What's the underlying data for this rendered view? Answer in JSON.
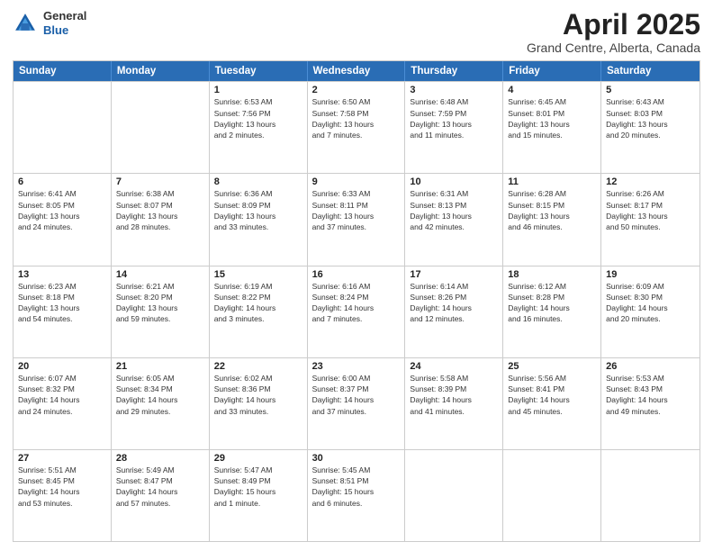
{
  "logo": {
    "general": "General",
    "blue": "Blue"
  },
  "header": {
    "month_year": "April 2025",
    "location": "Grand Centre, Alberta, Canada"
  },
  "weekdays": [
    "Sunday",
    "Monday",
    "Tuesday",
    "Wednesday",
    "Thursday",
    "Friday",
    "Saturday"
  ],
  "weeks": [
    [
      {
        "day": "",
        "info": ""
      },
      {
        "day": "",
        "info": ""
      },
      {
        "day": "1",
        "info": "Sunrise: 6:53 AM\nSunset: 7:56 PM\nDaylight: 13 hours\nand 2 minutes."
      },
      {
        "day": "2",
        "info": "Sunrise: 6:50 AM\nSunset: 7:58 PM\nDaylight: 13 hours\nand 7 minutes."
      },
      {
        "day": "3",
        "info": "Sunrise: 6:48 AM\nSunset: 7:59 PM\nDaylight: 13 hours\nand 11 minutes."
      },
      {
        "day": "4",
        "info": "Sunrise: 6:45 AM\nSunset: 8:01 PM\nDaylight: 13 hours\nand 15 minutes."
      },
      {
        "day": "5",
        "info": "Sunrise: 6:43 AM\nSunset: 8:03 PM\nDaylight: 13 hours\nand 20 minutes."
      }
    ],
    [
      {
        "day": "6",
        "info": "Sunrise: 6:41 AM\nSunset: 8:05 PM\nDaylight: 13 hours\nand 24 minutes."
      },
      {
        "day": "7",
        "info": "Sunrise: 6:38 AM\nSunset: 8:07 PM\nDaylight: 13 hours\nand 28 minutes."
      },
      {
        "day": "8",
        "info": "Sunrise: 6:36 AM\nSunset: 8:09 PM\nDaylight: 13 hours\nand 33 minutes."
      },
      {
        "day": "9",
        "info": "Sunrise: 6:33 AM\nSunset: 8:11 PM\nDaylight: 13 hours\nand 37 minutes."
      },
      {
        "day": "10",
        "info": "Sunrise: 6:31 AM\nSunset: 8:13 PM\nDaylight: 13 hours\nand 42 minutes."
      },
      {
        "day": "11",
        "info": "Sunrise: 6:28 AM\nSunset: 8:15 PM\nDaylight: 13 hours\nand 46 minutes."
      },
      {
        "day": "12",
        "info": "Sunrise: 6:26 AM\nSunset: 8:17 PM\nDaylight: 13 hours\nand 50 minutes."
      }
    ],
    [
      {
        "day": "13",
        "info": "Sunrise: 6:23 AM\nSunset: 8:18 PM\nDaylight: 13 hours\nand 54 minutes."
      },
      {
        "day": "14",
        "info": "Sunrise: 6:21 AM\nSunset: 8:20 PM\nDaylight: 13 hours\nand 59 minutes."
      },
      {
        "day": "15",
        "info": "Sunrise: 6:19 AM\nSunset: 8:22 PM\nDaylight: 14 hours\nand 3 minutes."
      },
      {
        "day": "16",
        "info": "Sunrise: 6:16 AM\nSunset: 8:24 PM\nDaylight: 14 hours\nand 7 minutes."
      },
      {
        "day": "17",
        "info": "Sunrise: 6:14 AM\nSunset: 8:26 PM\nDaylight: 14 hours\nand 12 minutes."
      },
      {
        "day": "18",
        "info": "Sunrise: 6:12 AM\nSunset: 8:28 PM\nDaylight: 14 hours\nand 16 minutes."
      },
      {
        "day": "19",
        "info": "Sunrise: 6:09 AM\nSunset: 8:30 PM\nDaylight: 14 hours\nand 20 minutes."
      }
    ],
    [
      {
        "day": "20",
        "info": "Sunrise: 6:07 AM\nSunset: 8:32 PM\nDaylight: 14 hours\nand 24 minutes."
      },
      {
        "day": "21",
        "info": "Sunrise: 6:05 AM\nSunset: 8:34 PM\nDaylight: 14 hours\nand 29 minutes."
      },
      {
        "day": "22",
        "info": "Sunrise: 6:02 AM\nSunset: 8:36 PM\nDaylight: 14 hours\nand 33 minutes."
      },
      {
        "day": "23",
        "info": "Sunrise: 6:00 AM\nSunset: 8:37 PM\nDaylight: 14 hours\nand 37 minutes."
      },
      {
        "day": "24",
        "info": "Sunrise: 5:58 AM\nSunset: 8:39 PM\nDaylight: 14 hours\nand 41 minutes."
      },
      {
        "day": "25",
        "info": "Sunrise: 5:56 AM\nSunset: 8:41 PM\nDaylight: 14 hours\nand 45 minutes."
      },
      {
        "day": "26",
        "info": "Sunrise: 5:53 AM\nSunset: 8:43 PM\nDaylight: 14 hours\nand 49 minutes."
      }
    ],
    [
      {
        "day": "27",
        "info": "Sunrise: 5:51 AM\nSunset: 8:45 PM\nDaylight: 14 hours\nand 53 minutes."
      },
      {
        "day": "28",
        "info": "Sunrise: 5:49 AM\nSunset: 8:47 PM\nDaylight: 14 hours\nand 57 minutes."
      },
      {
        "day": "29",
        "info": "Sunrise: 5:47 AM\nSunset: 8:49 PM\nDaylight: 15 hours\nand 1 minute."
      },
      {
        "day": "30",
        "info": "Sunrise: 5:45 AM\nSunset: 8:51 PM\nDaylight: 15 hours\nand 6 minutes."
      },
      {
        "day": "",
        "info": ""
      },
      {
        "day": "",
        "info": ""
      },
      {
        "day": "",
        "info": ""
      }
    ]
  ]
}
